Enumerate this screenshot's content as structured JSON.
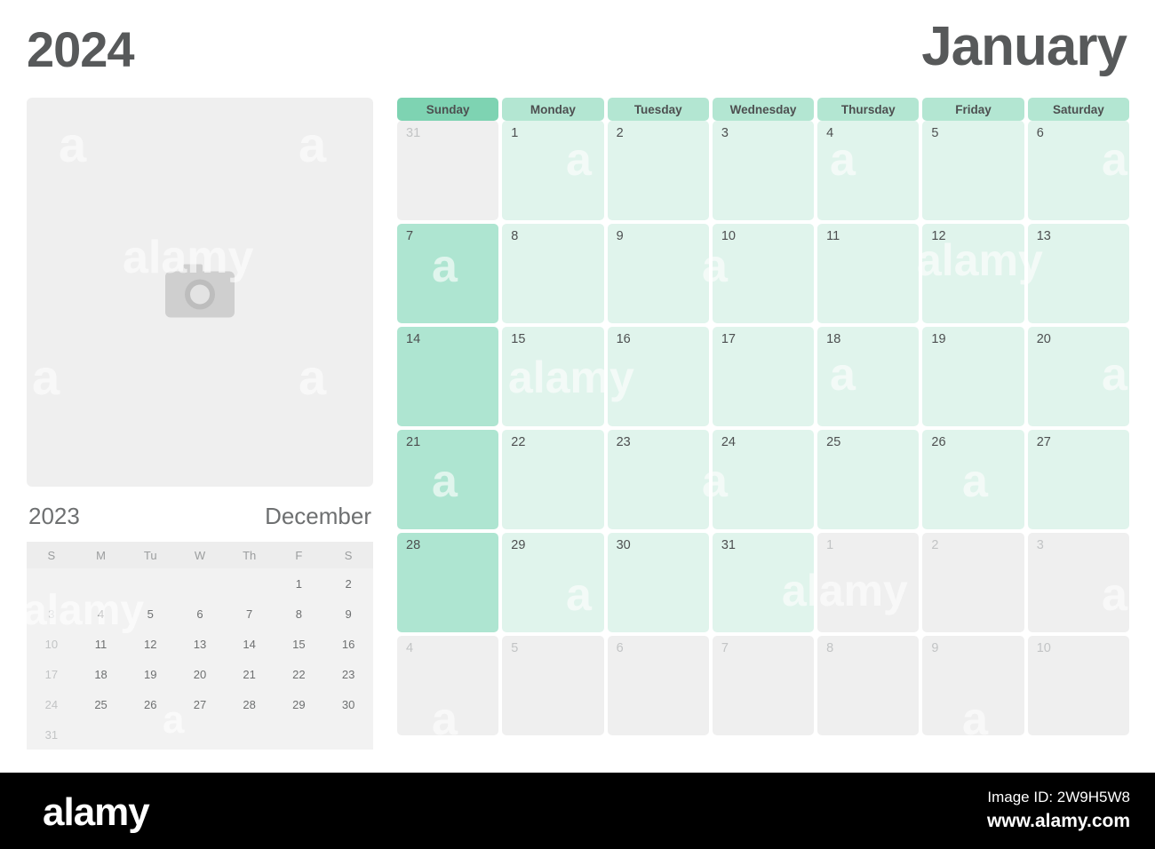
{
  "header": {
    "year": "2024",
    "month": "January"
  },
  "left_panel": {
    "photo_placeholder_icon": "camera-icon",
    "mini_calendar": {
      "year": "2023",
      "month": "December",
      "weekday_headers": [
        "S",
        "M",
        "Tu",
        "W",
        "Th",
        "F",
        "S"
      ],
      "weeks": [
        [
          "",
          "",
          "",
          "",
          "",
          "1",
          "2"
        ],
        [
          "3",
          "4",
          "5",
          "6",
          "7",
          "8",
          "9"
        ],
        [
          "10",
          "11",
          "12",
          "13",
          "14",
          "15",
          "16"
        ],
        [
          "17",
          "18",
          "19",
          "20",
          "21",
          "22",
          "23"
        ],
        [
          "24",
          "25",
          "26",
          "27",
          "28",
          "29",
          "30"
        ],
        [
          "31",
          "",
          "",
          "",
          "",
          "",
          ""
        ]
      ]
    }
  },
  "main_calendar": {
    "weekday_headers": [
      "Sunday",
      "Monday",
      "Tuesday",
      "Wednesday",
      "Thursday",
      "Friday",
      "Saturday"
    ],
    "weeks": [
      [
        {
          "n": "31",
          "outside": true
        },
        {
          "n": "1",
          "outside": false
        },
        {
          "n": "2",
          "outside": false
        },
        {
          "n": "3",
          "outside": false
        },
        {
          "n": "4",
          "outside": false
        },
        {
          "n": "5",
          "outside": false
        },
        {
          "n": "6",
          "outside": false
        }
      ],
      [
        {
          "n": "7",
          "outside": false
        },
        {
          "n": "8",
          "outside": false
        },
        {
          "n": "9",
          "outside": false
        },
        {
          "n": "10",
          "outside": false
        },
        {
          "n": "11",
          "outside": false
        },
        {
          "n": "12",
          "outside": false
        },
        {
          "n": "13",
          "outside": false
        }
      ],
      [
        {
          "n": "14",
          "outside": false
        },
        {
          "n": "15",
          "outside": false
        },
        {
          "n": "16",
          "outside": false
        },
        {
          "n": "17",
          "outside": false
        },
        {
          "n": "18",
          "outside": false
        },
        {
          "n": "19",
          "outside": false
        },
        {
          "n": "20",
          "outside": false
        }
      ],
      [
        {
          "n": "21",
          "outside": false
        },
        {
          "n": "22",
          "outside": false
        },
        {
          "n": "23",
          "outside": false
        },
        {
          "n": "24",
          "outside": false
        },
        {
          "n": "25",
          "outside": false
        },
        {
          "n": "26",
          "outside": false
        },
        {
          "n": "27",
          "outside": false
        }
      ],
      [
        {
          "n": "28",
          "outside": false
        },
        {
          "n": "29",
          "outside": false
        },
        {
          "n": "30",
          "outside": false
        },
        {
          "n": "31",
          "outside": false
        },
        {
          "n": "1",
          "outside": true
        },
        {
          "n": "2",
          "outside": true
        },
        {
          "n": "3",
          "outside": true
        }
      ],
      [
        {
          "n": "4",
          "outside": true
        },
        {
          "n": "5",
          "outside": true
        },
        {
          "n": "6",
          "outside": true
        },
        {
          "n": "7",
          "outside": true
        },
        {
          "n": "8",
          "outside": true
        },
        {
          "n": "9",
          "outside": true
        },
        {
          "n": "10",
          "outside": true
        }
      ]
    ]
  },
  "watermarks": {
    "word": "alamy",
    "letter": "a"
  },
  "footer": {
    "logo": "alamy",
    "image_id": "Image ID: 2W9H5W8",
    "url": "www.alamy.com"
  },
  "colors": {
    "sunday_header": "#7ed3b2",
    "weekday_header": "#b3e6d2",
    "sunday_cell": "#aee5d1",
    "weekday_cell": "#e0f4ec",
    "outside_cell": "#efefef",
    "title_text": "#57595a",
    "footer_bg": "#000000"
  }
}
